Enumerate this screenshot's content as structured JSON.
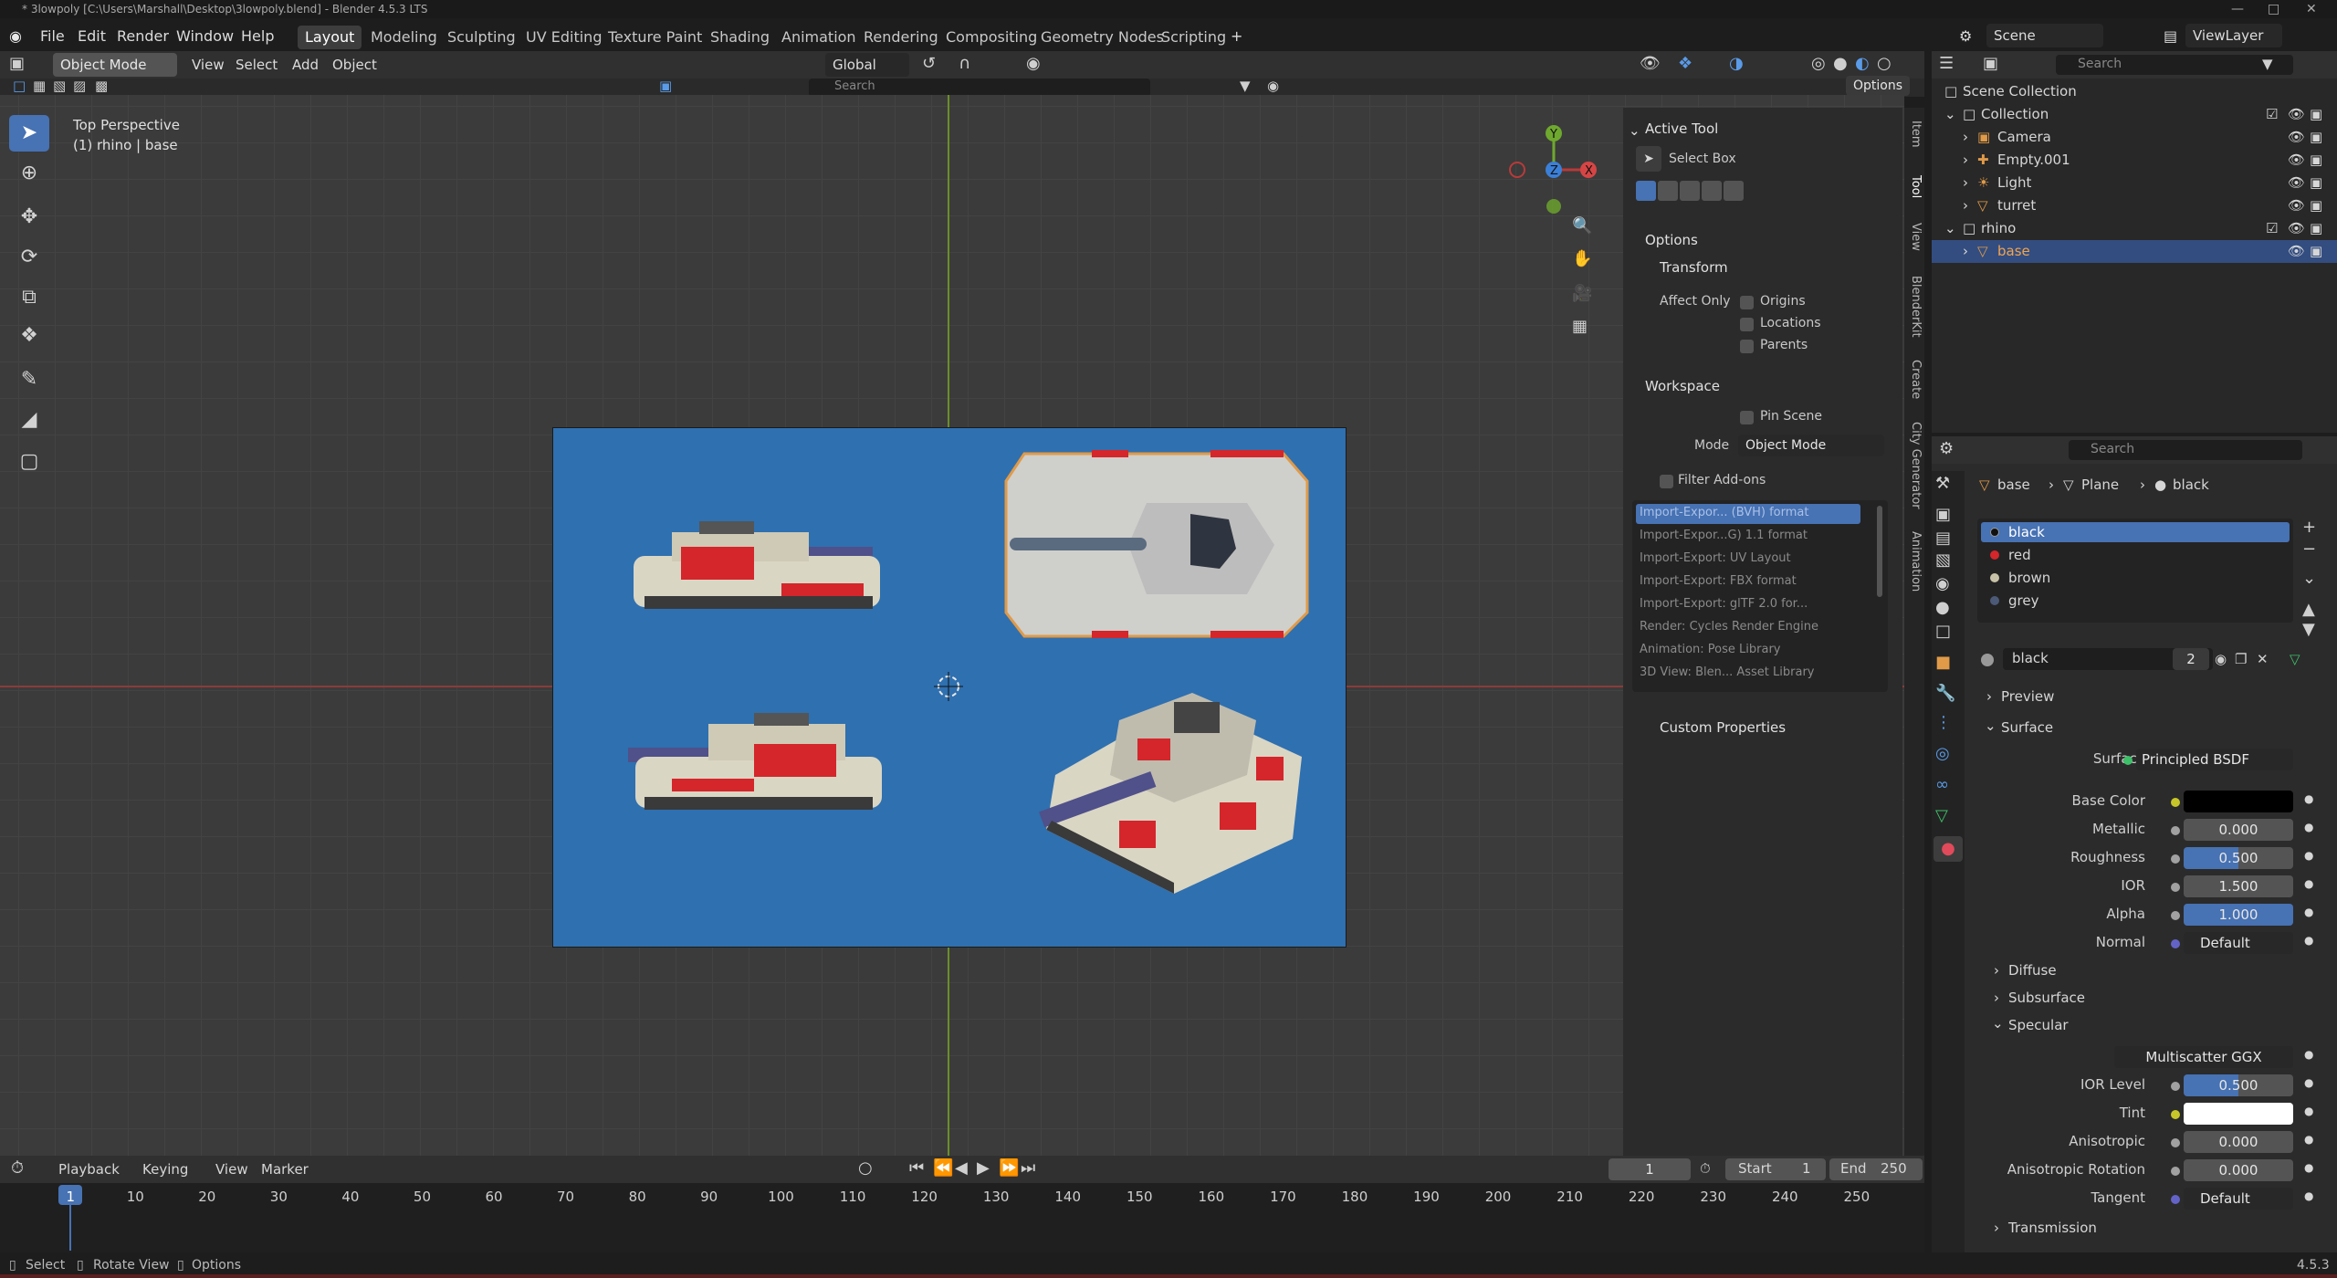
{
  "window": {
    "title": "* 3lowpoly [C:\\Users\\Marshall\\Desktop\\3lowpoly.blend] - Blender 4.5.3 LTS",
    "version": "4.5.3"
  },
  "menu": [
    "File",
    "Edit",
    "Render",
    "Window",
    "Help"
  ],
  "workspaces": [
    "Layout",
    "Modeling",
    "Sculpting",
    "UV Editing",
    "Texture Paint",
    "Shading",
    "Animation",
    "Rendering",
    "Compositing",
    "Geometry Nodes",
    "Scripting"
  ],
  "scene": {
    "name": "Scene",
    "view_layer": "ViewLayer"
  },
  "viewport_header": {
    "mode": "Object Mode",
    "menus": [
      "View",
      "Select",
      "Add",
      "Object"
    ],
    "orientation": "Global",
    "search_placeholder": "Search",
    "options": "Options"
  },
  "viewport": {
    "view_name": "Top Perspective",
    "object_info": "(1) rhino | base",
    "gizmo_axes": [
      "X",
      "Y",
      "Z"
    ]
  },
  "npanel": {
    "active_tool": {
      "title": "Active Tool",
      "tool": "Select Box"
    },
    "options": {
      "title": "Options",
      "transform": "Transform",
      "affect_only": "Affect Only",
      "items": [
        "Origins",
        "Locations",
        "Parents"
      ]
    },
    "workspace": {
      "title": "Workspace",
      "pin_scene": "Pin Scene",
      "mode_label": "Mode",
      "mode_value": "Object Mode",
      "filter_addons": "Filter Add-ons",
      "addons": [
        "Import-Expor... (BVH) format",
        "Import-Expor...G) 1.1 format",
        "Import-Export: UV Layout",
        "Import-Export: FBX format",
        "Import-Export: glTF 2.0 for...",
        "Render: Cycles Render Engine",
        "Animation: Pose Library",
        "3D View: Blen... Asset Library"
      ]
    },
    "custom_properties": "Custom Properties",
    "tabs": [
      "Item",
      "Tool",
      "View",
      "BlenderKit",
      "Create",
      "City Generator",
      "Animation"
    ]
  },
  "outliner": {
    "search_placeholder": "Search",
    "rows": [
      {
        "label": "Scene Collection",
        "indent": 0
      },
      {
        "label": "Collection",
        "indent": 1
      },
      {
        "label": "Camera",
        "indent": 2
      },
      {
        "label": "Empty.001",
        "indent": 2
      },
      {
        "label": "Light",
        "indent": 2
      },
      {
        "label": "turret",
        "indent": 2
      },
      {
        "label": "rhino",
        "indent": 1
      },
      {
        "label": "base",
        "indent": 2
      }
    ]
  },
  "properties": {
    "search_placeholder": "Search",
    "breadcrumb": [
      "base",
      "Plane",
      "black"
    ],
    "materials": [
      "black",
      "red",
      "brown",
      "grey"
    ],
    "material_name": "black",
    "users": "2",
    "sections": {
      "preview": "Preview",
      "surface": "Surface",
      "diffuse": "Diffuse",
      "subsurface": "Subsurface",
      "specular": "Specular",
      "transmission": "Transmission"
    },
    "surface_label": "Surface",
    "surface_value": "Principled BSDF",
    "fields": [
      {
        "label": "Base Color",
        "value": "",
        "type": "color",
        "color": "#000000"
      },
      {
        "label": "Metallic",
        "value": "0.000",
        "fill": 0
      },
      {
        "label": "Roughness",
        "value": "0.500",
        "fill": 0.5
      },
      {
        "label": "IOR",
        "value": "1.500",
        "fill": 0
      },
      {
        "label": "Alpha",
        "value": "1.000",
        "fill": 1
      },
      {
        "label": "Normal",
        "value": "Default",
        "type": "link"
      }
    ],
    "specular_fields": [
      {
        "label": "",
        "value": "Multiscatter GGX",
        "type": "dropdown"
      },
      {
        "label": "IOR Level",
        "value": "0.500",
        "fill": 0.5
      },
      {
        "label": "Tint",
        "value": "",
        "type": "color",
        "color": "#ffffff"
      },
      {
        "label": "Anisotropic",
        "value": "0.000",
        "fill": 0
      },
      {
        "label": "Anisotropic Rotation",
        "value": "0.000",
        "fill": 0
      },
      {
        "label": "Tangent",
        "value": "Default",
        "type": "link"
      }
    ]
  },
  "timeline": {
    "menus": [
      "Playback",
      "Keying",
      "View",
      "Marker"
    ],
    "current_frame": "1",
    "start_label": "Start",
    "start": "1",
    "end_label": "End",
    "end": "250",
    "ticks": [
      "1",
      "10",
      "20",
      "30",
      "40",
      "50",
      "60",
      "70",
      "80",
      "90",
      "100",
      "110",
      "120",
      "130",
      "140",
      "150",
      "160",
      "170",
      "180",
      "190",
      "200",
      "210",
      "220",
      "230",
      "240",
      "250"
    ]
  },
  "statusbar": {
    "items": [
      "Select",
      "Rotate View",
      "Options"
    ]
  }
}
